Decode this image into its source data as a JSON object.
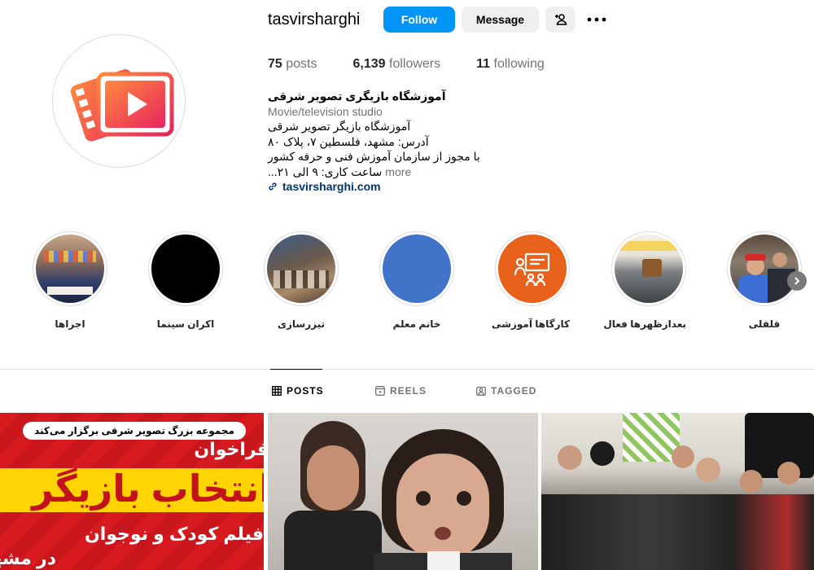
{
  "profile": {
    "username": "tasvirsharghi",
    "follow_label": "Follow",
    "message_label": "Message",
    "stats": {
      "posts_count": "75",
      "posts_label": "posts",
      "followers_count": "6,139",
      "followers_label": "followers",
      "following_count": "11",
      "following_label": "following"
    },
    "bio": {
      "name": "آموزشگاه بازیگری تصویر شرقی",
      "category": "Movie/television studio",
      "lines": [
        "آموزشگاه بازیگر تصویر شرقی",
        "آدرس: مشهد، فلسطین ۷، پلاک ۸۰",
        "با مجوز از سازمان آموزش فنی و حرفه کشور",
        "ساعت کاری: ۹ الی ۲۱..."
      ],
      "more_label": "more",
      "link": "tasvirsharghi.com"
    },
    "accent_color": "#0095f6"
  },
  "highlights": [
    {
      "label": "اجراها",
      "icon": "stage-performance-photo"
    },
    {
      "label": "اکران سینما",
      "icon": "black-circle"
    },
    {
      "label": "تیزرسازی",
      "icon": "film-set-photo"
    },
    {
      "label": "خانم معلم",
      "icon": "blue-sky"
    },
    {
      "label": "کارگاها آموزشی",
      "icon": "presentation-icon"
    },
    {
      "label": "بعدازظهرها فعال",
      "icon": "classroom-photo"
    },
    {
      "label": "قلقلی",
      "icon": "people-photo"
    }
  ],
  "tabs": [
    {
      "label": "POSTS",
      "icon": "grid-icon",
      "active": true
    },
    {
      "label": "REELS",
      "icon": "reels-icon",
      "active": false
    },
    {
      "label": "TAGGED",
      "icon": "tagged-icon",
      "active": false
    }
  ],
  "posts": {
    "post1": {
      "top_text": "مجموعه بزرگ تصویر شرقی برگزار می‌کند",
      "line1": "فراخوان",
      "line2": "انتخاب بازیگر",
      "line3": "فیلم کودک و نوجوان",
      "line4": "در مشهد"
    }
  }
}
